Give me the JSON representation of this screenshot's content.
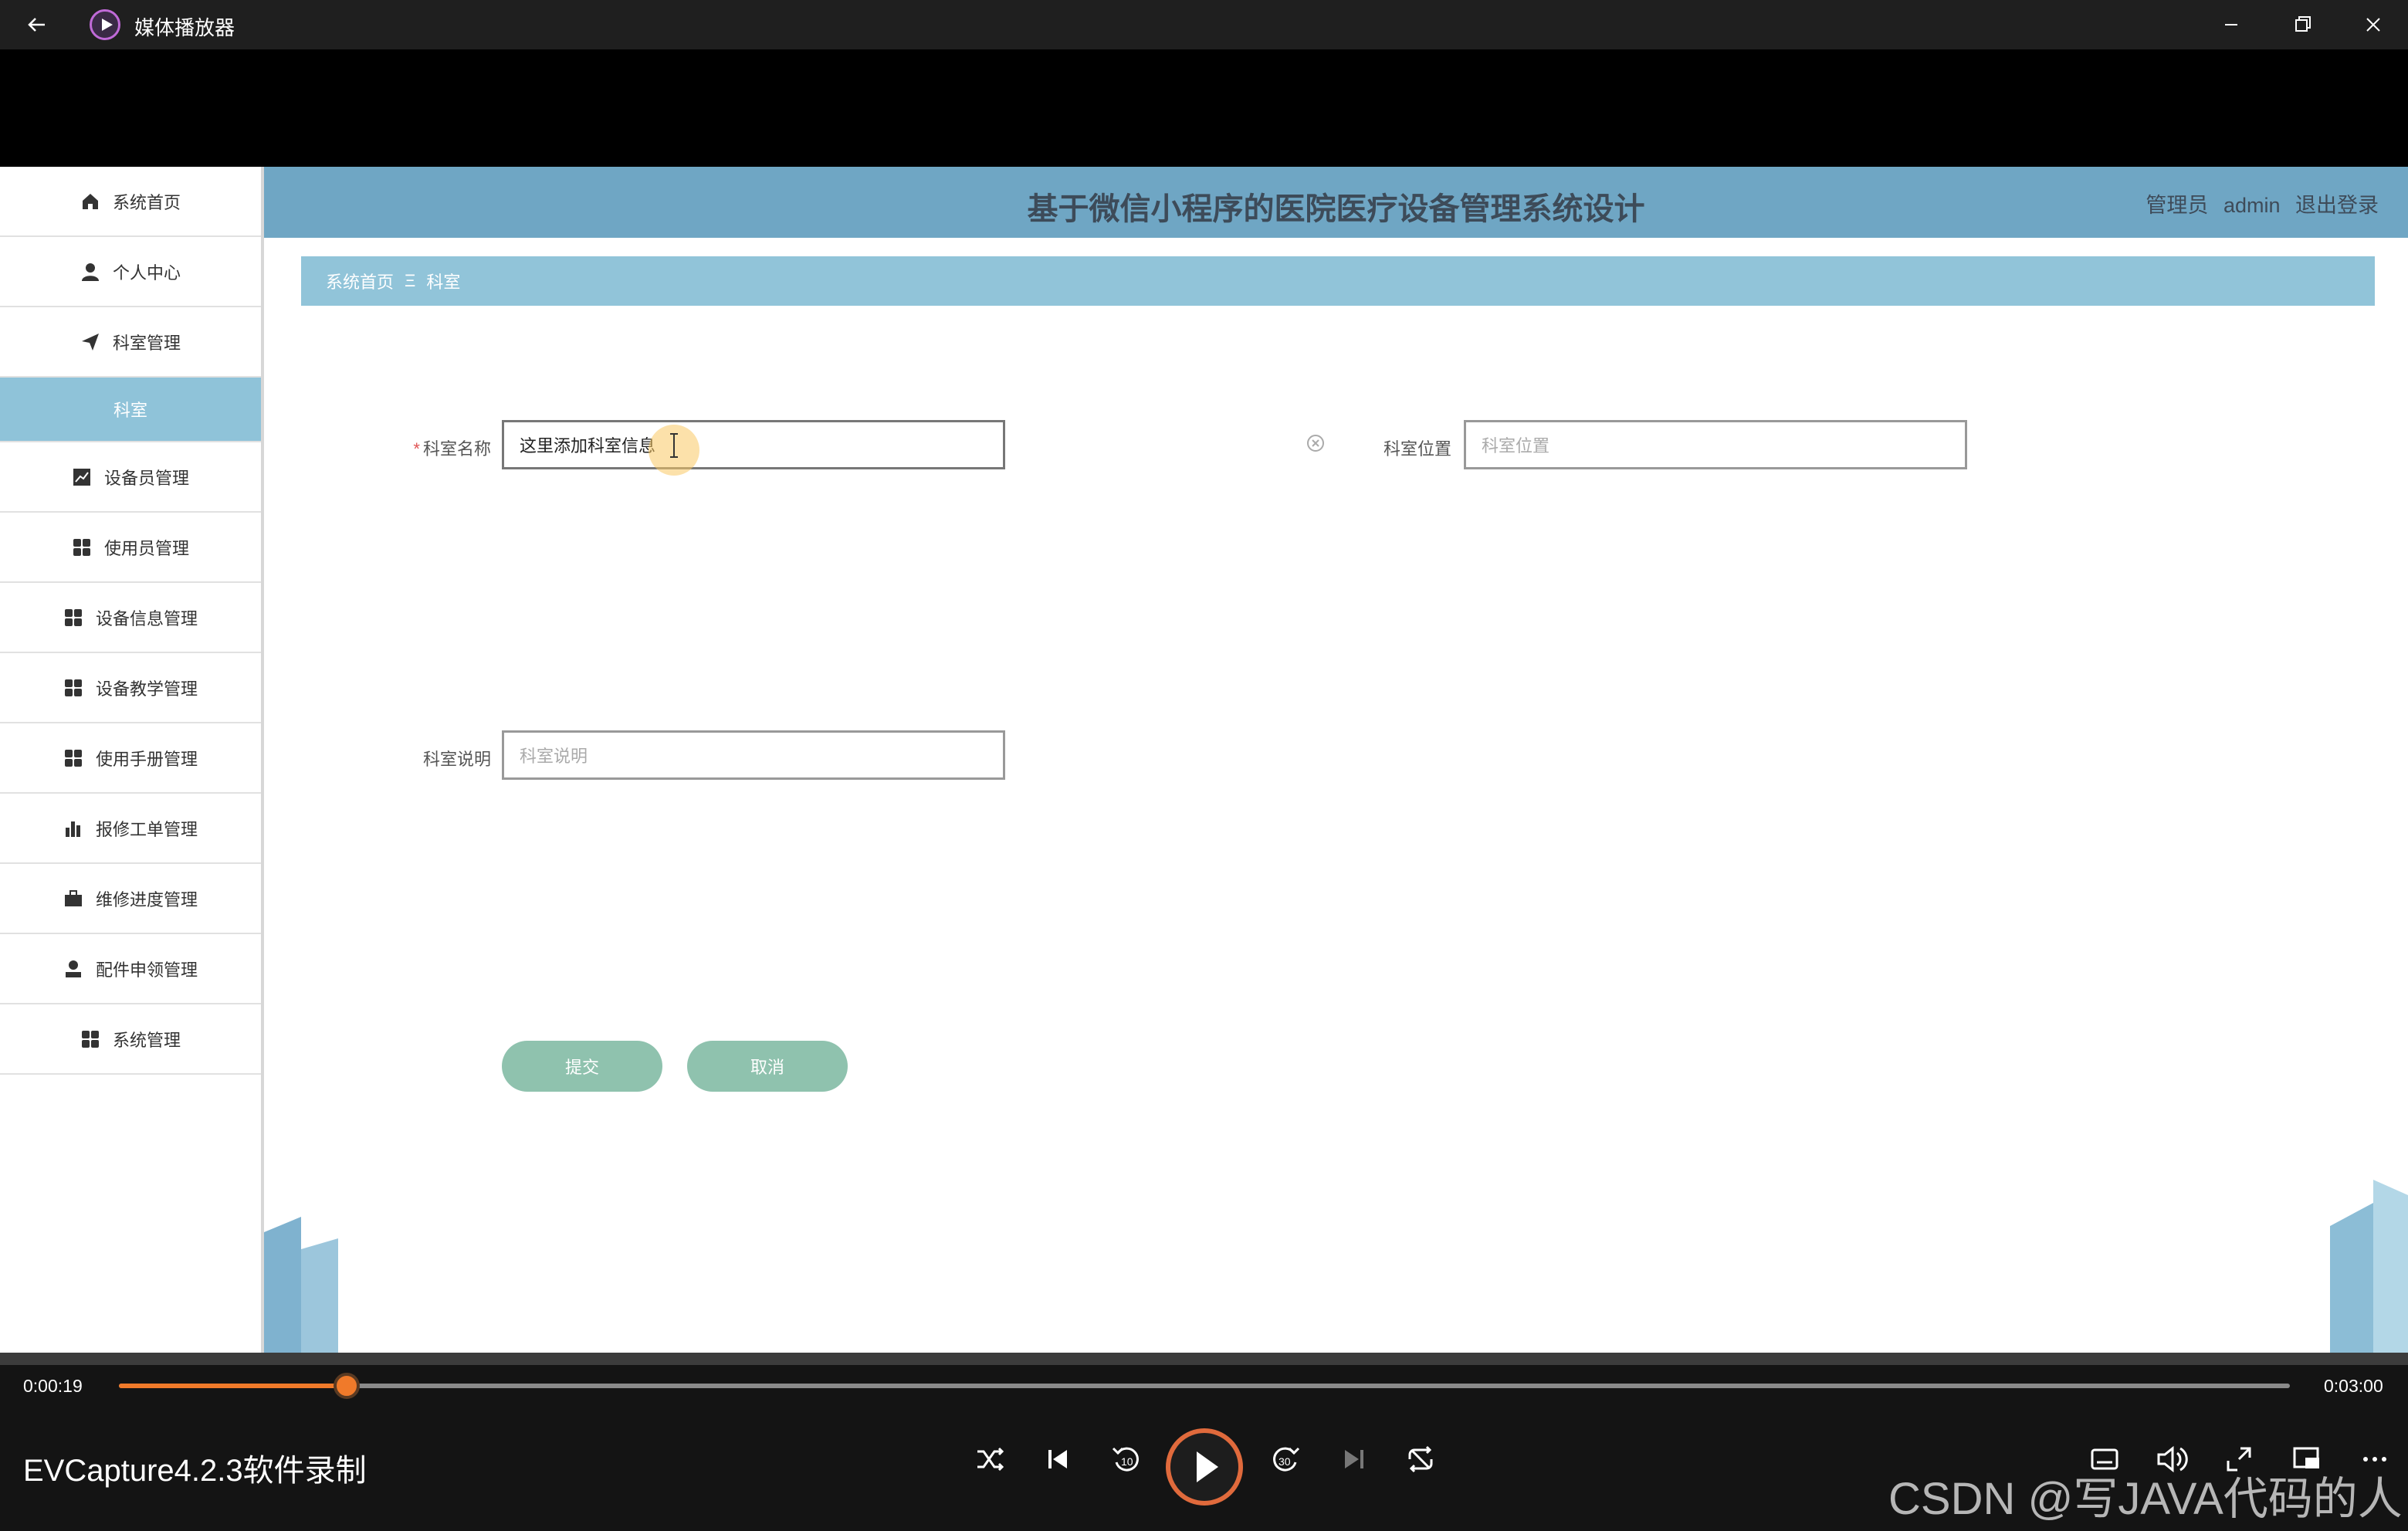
{
  "window": {
    "title": "媒体播放器",
    "icons": [
      "back-arrow-icon",
      "media-player-icon",
      "minimize-icon",
      "maximize-icon",
      "close-icon"
    ]
  },
  "header": {
    "title": "基于微信小程序的医院医疗设备管理系统设计",
    "user_role": "管理员",
    "user_name": "admin",
    "logout": "退出登录"
  },
  "sidebar": {
    "items": [
      {
        "label": "系统首页",
        "icon": "home-icon"
      },
      {
        "label": "个人中心",
        "icon": "user-icon"
      },
      {
        "label": "科室管理",
        "icon": "send-icon"
      },
      {
        "label": "科室",
        "icon": ""
      },
      {
        "label": "设备员管理",
        "icon": "chart-icon"
      },
      {
        "label": "使用员管理",
        "icon": "grid-icon"
      },
      {
        "label": "设备信息管理",
        "icon": "grid-icon"
      },
      {
        "label": "设备教学管理",
        "icon": "grid-icon"
      },
      {
        "label": "使用手册管理",
        "icon": "grid-icon"
      },
      {
        "label": "报修工单管理",
        "icon": "bar-chart-icon"
      },
      {
        "label": "维修进度管理",
        "icon": "briefcase-icon"
      },
      {
        "label": "配件申领管理",
        "icon": "person-icon"
      },
      {
        "label": "系统管理",
        "icon": "grid-icon"
      }
    ]
  },
  "breadcrumb": {
    "home": "系统首页",
    "separator": "Ξ",
    "current": "科室"
  },
  "form": {
    "name_label": "科室名称",
    "required_mark": "*",
    "name_value": "这里添加科室信息",
    "location_label": "科室位置",
    "location_placeholder": "科室位置",
    "desc_label": "科室说明",
    "desc_placeholder": "科室说明",
    "submit": "提交",
    "cancel": "取消"
  },
  "player": {
    "current_time": "0:00:19",
    "total_time": "0:03:00",
    "progress_fraction": 0.105,
    "capture_label": "EVCapture4.2.3软件录制",
    "watermark": "CSDN @写JAVA代码的人",
    "controls": [
      "shuffle-icon",
      "previous-icon",
      "rewind-10-icon",
      "play-icon",
      "forward-30-icon",
      "next-icon",
      "repeat-icon",
      "subtitles-icon",
      "volume-icon",
      "fullscreen-icon",
      "mini-view-icon",
      "more-icon"
    ]
  },
  "colors": {
    "header": "#6fa6c4",
    "breadcrumb": "#91c4d9",
    "active_sidebar": "#8fc3d9",
    "button": "#8fc2ae",
    "progress": "#f07a2a"
  }
}
